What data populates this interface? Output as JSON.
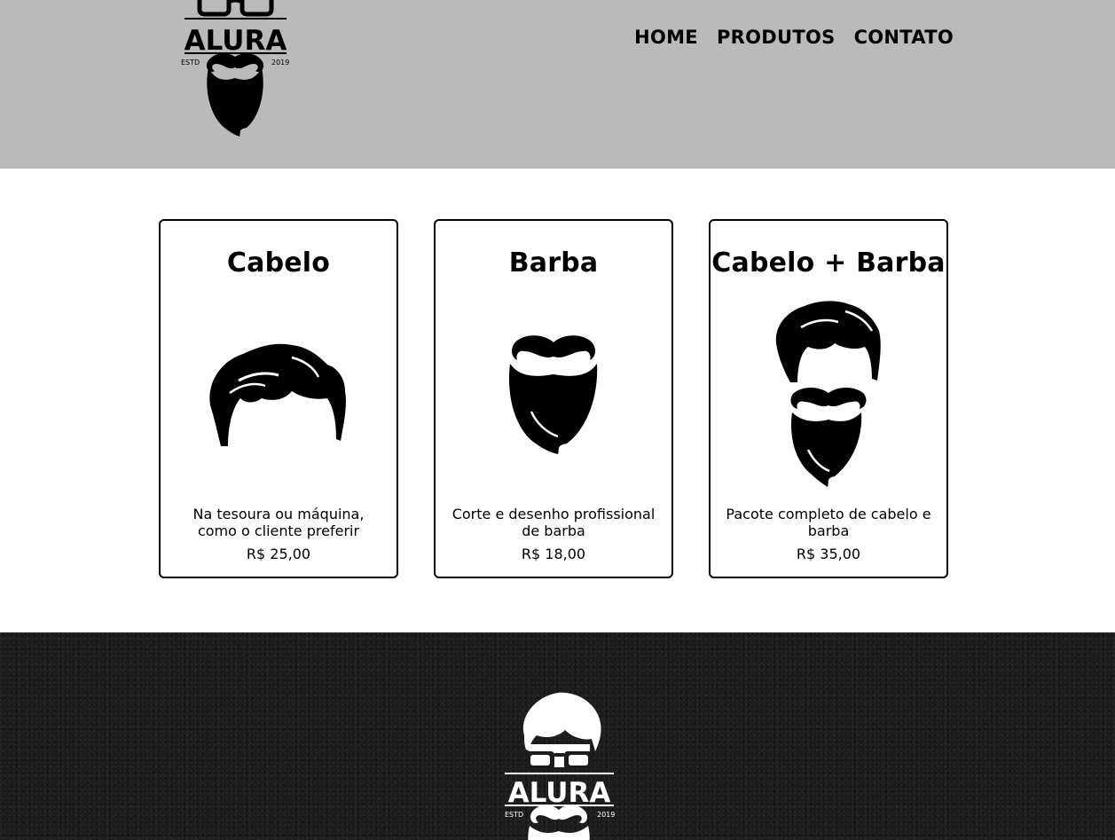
{
  "brand": {
    "name": "ALURA",
    "estd": "ESTD",
    "year": "2019"
  },
  "nav": {
    "items": [
      {
        "label": "HOME"
      },
      {
        "label": "PRODUTOS"
      },
      {
        "label": "CONTATO"
      }
    ]
  },
  "products": [
    {
      "title": "Cabelo",
      "icon": "hair-icon",
      "description": "Na tesoura ou máquina, como o cliente preferir",
      "price": "R$ 25,00"
    },
    {
      "title": "Barba",
      "icon": "beard-icon",
      "description": "Corte e desenho profissional de barba",
      "price": "R$ 18,00"
    },
    {
      "title": "Cabelo + Barba",
      "icon": "hair-and-beard-icon",
      "description": "Pacote completo de cabelo e barba",
      "price": "R$ 35,00"
    }
  ],
  "colors": {
    "header_bg": "#bababa",
    "page_bg": "#ffffff",
    "footer_bg": "#1c1c1c",
    "text": "#000000"
  }
}
